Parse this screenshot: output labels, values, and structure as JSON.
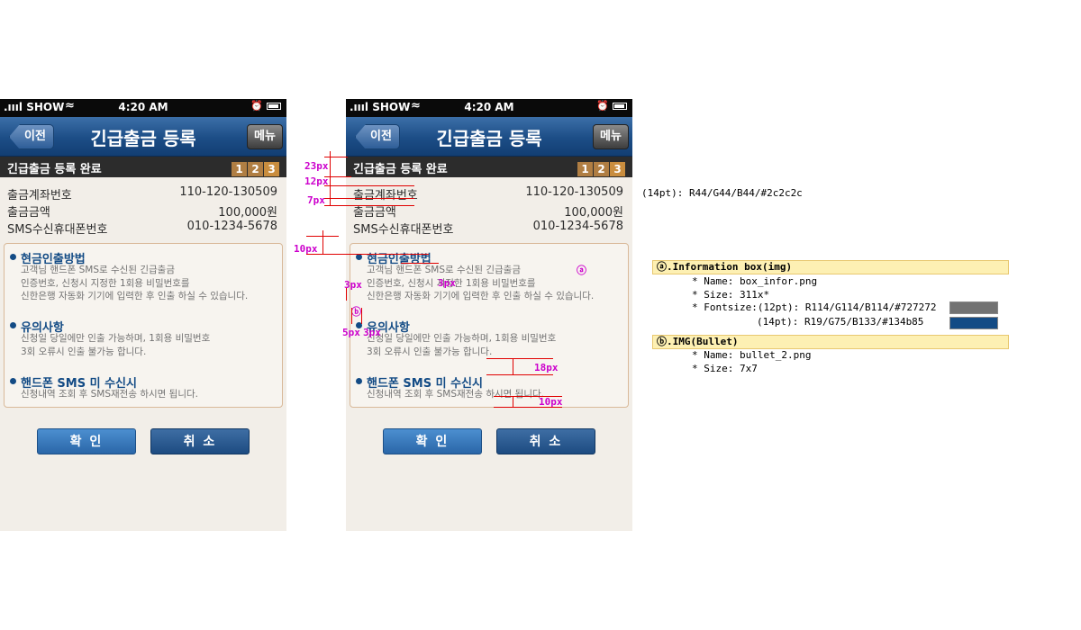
{
  "status_bar": {
    "carrier": ".ıııl SHOW",
    "wifi": "≈",
    "time": "4:20 AM",
    "right": "⏰"
  },
  "nav": {
    "back_label": "이전",
    "title": "긴급출금 등록",
    "menu_label": "메뉴"
  },
  "stepbar": {
    "title": "긴급출금 등록 완료",
    "steps": [
      "1",
      "2",
      "3"
    ]
  },
  "details": [
    {
      "label": "출금계좌번호",
      "value": "110-120-130509"
    },
    {
      "label": "출금금액",
      "value": "100,000원"
    },
    {
      "label": "SMS수신휴대폰번호",
      "value": "010-1234-5678"
    }
  ],
  "info_sections": [
    {
      "heading": "현금인출방법",
      "lines": [
        "고객님 핸드폰 SMS로 수신된 긴급출금",
        "인증번호, 신청시 지정한 1회용 비밀번호를",
        "신한은행 자동화 기기에 입력한 후 인출 하실 수 있습니다."
      ]
    },
    {
      "heading": "유의사항",
      "lines": [
        "신청일 당일에만 인출 가능하며, 1회용 비밀번호",
        "3회 오류시 인출 불가능 합니다."
      ]
    },
    {
      "heading": "핸드폰 SMS 미 수신시",
      "lines": [
        "신청내역 조회 후 SMS재전송 하시면 됩니다."
      ]
    }
  ],
  "buttons": {
    "confirm": "확 인",
    "cancel": "취 소"
  },
  "annotations": {
    "m23": "23px",
    "m12": "12px",
    "m7": "7px",
    "m10a": "10px",
    "m3a": "3px",
    "m3b": "3px",
    "m5": "5px",
    "m3c": "3px",
    "m18": "18px",
    "m10b": "10px",
    "marker_a": "ⓐ",
    "marker_b": "ⓑ"
  },
  "spec": {
    "font_14pt": "(14pt): R44/G44/B44/#2c2c2c",
    "box_a_title": "ⓐ.Information box(img)",
    "box_a_name": "* Name: box_infor.png",
    "box_a_size": "* Size: 311x*",
    "box_a_font12": "* Fontsize:(12pt): R114/G114/B114/#727272",
    "box_a_font14": "(14pt): R19/G75/B133/#134b85",
    "box_b_title": "ⓑ.IMG(Bullet)",
    "box_b_name": "* Name: bullet_2.png",
    "box_b_size": "* Size: 7x7"
  },
  "colors": {
    "gray_text": "#727272",
    "blue_heading": "#134b85",
    "dark_text": "#2c2c2c"
  }
}
